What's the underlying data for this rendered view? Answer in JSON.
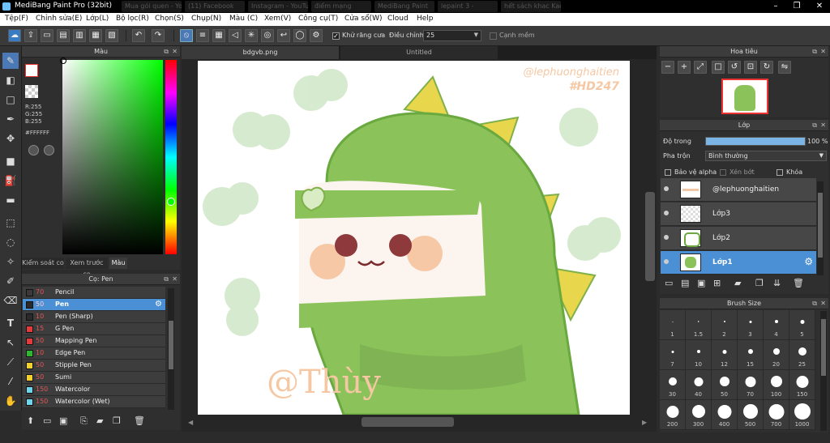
{
  "window": {
    "title": "MediBang Paint Pro (32bit)"
  },
  "ghost_tabs": [
    "Mua gói quen - YouTube",
    "(11) Facebook",
    "Instagram - YouTube",
    "điểm mạng",
    "MediBang Paint",
    "lepaint 3 -",
    "hết sách khac Kao"
  ],
  "menu": [
    "Tệp(F)",
    "Chỉnh sửa(E)",
    "Lớp(L)",
    "Bộ lọc(R)",
    "Chọn(S)",
    "Chụp(N)",
    "Màu (C)",
    "Xem(V)",
    "Công cụ(T)",
    "Cửa sổ(W)",
    "Cloud",
    "Help"
  ],
  "toolbar": {
    "antialias_label": "Khử răng cưa",
    "adjust_label": "Điều chỉnh",
    "adjust_value": "25",
    "sharp_edge_label": "Cạnh mềm"
  },
  "color_panel": {
    "title": "Màu",
    "r": "R:255",
    "g": "G:255",
    "b": "B:255",
    "hex": "#FFFFFF",
    "tabs": [
      "Kiểm soát co",
      "Xem trước co",
      "Màu"
    ]
  },
  "brush_panel": {
    "title": "Cọ: Pen",
    "items": [
      {
        "size": "70",
        "name": "Pencil",
        "color": "#3a3a3a",
        "selected": false
      },
      {
        "size": "50",
        "name": "Pen",
        "color": "#2a2a2a",
        "selected": true
      },
      {
        "size": "10",
        "name": "Pen (Sharp)",
        "color": "#2a2a2a",
        "selected": false
      },
      {
        "size": "15",
        "name": "G Pen",
        "color": "#e33b3b",
        "selected": false
      },
      {
        "size": "50",
        "name": "Mapping Pen",
        "color": "#e33b3b",
        "selected": false
      },
      {
        "size": "10",
        "name": "Edge Pen",
        "color": "#2db82d",
        "selected": false
      },
      {
        "size": "50",
        "name": "Stipple Pen",
        "color": "#f3d12a",
        "selected": false
      },
      {
        "size": "50",
        "name": "Sumi",
        "color": "#f3d12a",
        "selected": false
      },
      {
        "size": "150",
        "name": "Watercolor",
        "color": "#6ed5ea",
        "selected": false
      },
      {
        "size": "150",
        "name": "Watercolor (Wet)",
        "color": "#6ed5ea",
        "selected": false
      }
    ]
  },
  "document_tabs": [
    "bdgvb.png",
    "Untitled"
  ],
  "canvas_art": {
    "watermark1": "@lephuonghaitien",
    "watermark2": "#HD247",
    "signature": "@Thùy"
  },
  "navigator": {
    "title": "Hoa tiêu"
  },
  "layer_panel": {
    "title": "Lớp",
    "opacity_label": "Độ trong",
    "opacity_value": "100 %",
    "opacity_fraction": 1.0,
    "blend_label": "Pha trộn",
    "blend_value": "Bình thường",
    "protect_alpha": "Bảo vệ alpha",
    "clipping": "Xén bớt",
    "lock": "Khóa",
    "layers": [
      {
        "name": "@lephuonghaitien",
        "selected": false
      },
      {
        "name": "Lớp3",
        "selected": false
      },
      {
        "name": "Lớp2",
        "selected": false
      },
      {
        "name": "Lớp1",
        "selected": true
      }
    ]
  },
  "brush_size_panel": {
    "title": "Brush Size",
    "sizes": [
      "1",
      "1.5",
      "2",
      "3",
      "4",
      "5",
      "7",
      "10",
      "12",
      "15",
      "20",
      "25",
      "30",
      "40",
      "50",
      "70",
      "100",
      "150",
      "200",
      "300",
      "400",
      "500",
      "700",
      "1000"
    ]
  }
}
